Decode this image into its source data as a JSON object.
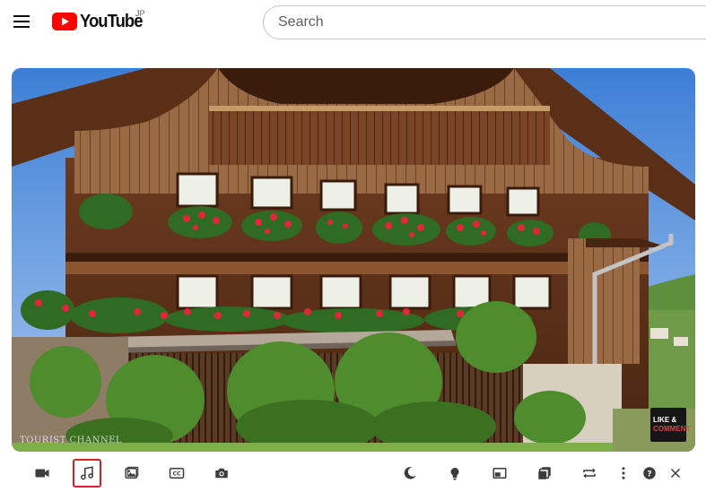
{
  "header": {
    "menu_icon": "hamburger-menu-icon",
    "logo_text": "YouTube",
    "logo_region": "JP",
    "brand_color": "#ff0000",
    "search": {
      "placeholder": "Search",
      "value": ""
    }
  },
  "video": {
    "watermark": "TOURIST CHANNEL",
    "badge_line1": "LIKE &",
    "badge_line2": "COMMENT"
  },
  "toolbar": {
    "left_buttons": [
      {
        "icon": "video-camera-icon",
        "active": false
      },
      {
        "icon": "music-note-icon",
        "active": true
      },
      {
        "icon": "image-icon",
        "active": false
      },
      {
        "icon": "closed-captions-icon",
        "active": false
      },
      {
        "icon": "camera-icon",
        "active": false
      }
    ],
    "right_buttons": [
      {
        "icon": "moon-icon"
      },
      {
        "icon": "lightbulb-icon"
      },
      {
        "icon": "picture-in-picture-icon"
      },
      {
        "icon": "stack-icon"
      },
      {
        "icon": "repeat-icon"
      },
      {
        "icon": "more-vertical-icon"
      },
      {
        "icon": "help-icon"
      },
      {
        "icon": "close-icon"
      }
    ],
    "active_outline_color": "#d9202a"
  }
}
